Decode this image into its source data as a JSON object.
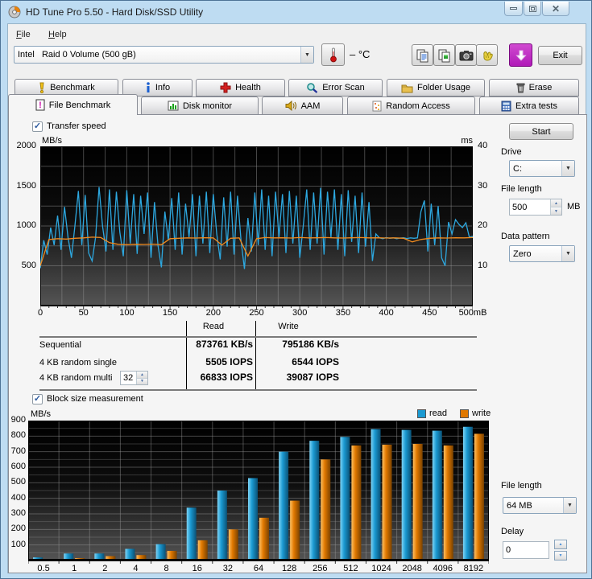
{
  "window": {
    "title": "HD Tune Pro 5.50 - Hard Disk/SSD Utility"
  },
  "menu": {
    "items": [
      "File",
      "Help"
    ]
  },
  "toolbar": {
    "drive_select": "Intel   Raid 0 Volume (500 gB)",
    "temperature": "– °C",
    "icons": [
      "thermometer-icon",
      "copy-text-icon",
      "copy-image-icon",
      "camera-icon",
      "hand-icon",
      "download-icon"
    ],
    "exit_label": "Exit"
  },
  "tabs": {
    "row1": [
      {
        "label": "Benchmark",
        "icon": "benchmark-icon"
      },
      {
        "label": "Info",
        "icon": "info-icon"
      },
      {
        "label": "Health",
        "icon": "health-icon"
      },
      {
        "label": "Error Scan",
        "icon": "error-scan-icon"
      },
      {
        "label": "Folder Usage",
        "icon": "folder-icon"
      },
      {
        "label": "Erase",
        "icon": "erase-icon"
      }
    ],
    "row2": [
      {
        "label": "File Benchmark",
        "icon": "file-benchmark-icon",
        "active": true
      },
      {
        "label": "Disk monitor",
        "icon": "disk-monitor-icon"
      },
      {
        "label": "AAM",
        "icon": "speaker-icon"
      },
      {
        "label": "Random Access",
        "icon": "random-access-icon"
      },
      {
        "label": "Extra tests",
        "icon": "extra-tests-icon"
      }
    ]
  },
  "controls": {
    "transfer_speed_label": "Transfer speed",
    "start_label": "Start",
    "drive_label": "Drive",
    "drive_value": "C:",
    "file_length_label": "File length",
    "file_length_value": "500",
    "file_length_unit": "MB",
    "data_pattern_label": "Data pattern",
    "data_pattern_value": "Zero",
    "block_size_label": "Block size measurement",
    "file_length2_label": "File length",
    "file_length2_value": "64 MB",
    "delay_label": "Delay",
    "delay_value": "0",
    "queue_depth": "32"
  },
  "results": {
    "col_read": "Read",
    "col_write": "Write",
    "rows": [
      {
        "label": "Sequential",
        "read": "873761 KB/s",
        "write": "795186 KB/s"
      },
      {
        "label": "4 KB random single",
        "read": "5505 IOPS",
        "write": "6544 IOPS"
      },
      {
        "label": "4 KB random multi",
        "read": "66833 IOPS",
        "write": "39087 IOPS"
      }
    ]
  },
  "legend": [
    {
      "label": "read",
      "color": "#1b9ad2"
    },
    {
      "label": "write",
      "color": "#e07800"
    }
  ],
  "chart_data": [
    {
      "type": "line",
      "title": "Transfer speed",
      "ylabel_left": "MB/s",
      "ylabel_right": "ms",
      "ylim_left": [
        0,
        2000
      ],
      "ylim_right": [
        0,
        40
      ],
      "xlim": [
        0,
        500
      ],
      "yticks_left": [
        500,
        1000,
        1500,
        2000
      ],
      "yticks_right": [
        10,
        20,
        30,
        40
      ],
      "xtick_values": [
        0,
        50,
        100,
        150,
        200,
        250,
        300,
        350,
        400,
        450,
        500
      ],
      "xtick_labels": [
        "0",
        "50",
        "100",
        "150",
        "200",
        "250",
        "300",
        "350",
        "400",
        "450",
        "500mB"
      ],
      "grid": {
        "x_step": 25,
        "y_step": 250
      },
      "series": [
        {
          "name": "read speed",
          "color": "#2da8e0",
          "x_step": 4,
          "values": [
            470,
            820,
            640,
            980,
            760,
            1130,
            700,
            1240,
            860,
            600,
            1000,
            1440,
            760,
            1390,
            660,
            560,
            860,
            1490,
            1000,
            680,
            1460,
            700,
            1430,
            920,
            620,
            1450,
            780,
            1400,
            650,
            1380,
            900,
            1420,
            600,
            1300,
            760,
            480,
            1180,
            820,
            1350,
            700,
            1420,
            640,
            1280,
            860,
            1400,
            620,
            1380,
            780,
            1430,
            660,
            1400,
            900,
            580,
            1360,
            740,
            1430,
            640,
            1380,
            820,
            460,
            1100,
            680,
            1420,
            760,
            1460,
            700,
            1380,
            620,
            1430,
            860,
            1400,
            660,
            1440,
            780,
            1380,
            600,
            1000,
            1460,
            700,
            1420,
            780,
            1480,
            640,
            1430,
            860,
            1460,
            700,
            1400,
            620,
            1450,
            800,
            1380,
            660,
            1420,
            740,
            1300,
            560,
            900,
            850,
            840,
            855,
            845,
            850,
            840,
            848,
            852,
            842,
            850,
            845,
            850,
            1180,
            1320,
            680,
            1280,
            760,
            1250,
            600,
            500,
            1050,
            900,
            1080,
            1020,
            980,
            1040,
            860,
            870
          ]
        },
        {
          "name": "write speed",
          "color": "#f08a1e",
          "x_step": 10,
          "values": [
            500,
            830,
            840,
            835,
            845,
            850,
            860,
            855,
            790,
            770,
            765,
            770,
            768,
            772,
            765,
            840,
            845,
            850,
            848,
            852,
            850,
            760,
            845,
            850,
            622,
            840,
            855,
            850,
            852,
            848,
            855,
            850,
            852,
            855,
            850,
            848,
            852,
            855,
            850,
            852,
            848,
            850,
            845,
            800,
            830,
            845,
            850,
            848,
            852,
            850,
            855
          ]
        }
      ]
    },
    {
      "type": "bar",
      "title": "Block size measurement",
      "ylabel": "MB/s",
      "ylim": [
        0,
        900
      ],
      "yticks": [
        100,
        200,
        300,
        400,
        500,
        600,
        700,
        800,
        900
      ],
      "grid_y_step": 50,
      "categories": [
        "0.5",
        "1",
        "2",
        "4",
        "8",
        "16",
        "32",
        "64",
        "128",
        "256",
        "512",
        "1024",
        "2048",
        "4096",
        "8192"
      ],
      "legend_position": "top-right",
      "series": [
        {
          "name": "read",
          "color": "#1b9ad2",
          "values": [
            20,
            45,
            45,
            75,
            105,
            340,
            450,
            530,
            700,
            770,
            795,
            845,
            840,
            835,
            860
          ]
        },
        {
          "name": "write",
          "color": "#e07800",
          "values": [
            8,
            15,
            28,
            35,
            62,
            130,
            200,
            275,
            385,
            650,
            740,
            745,
            750,
            740,
            815
          ]
        }
      ]
    }
  ]
}
